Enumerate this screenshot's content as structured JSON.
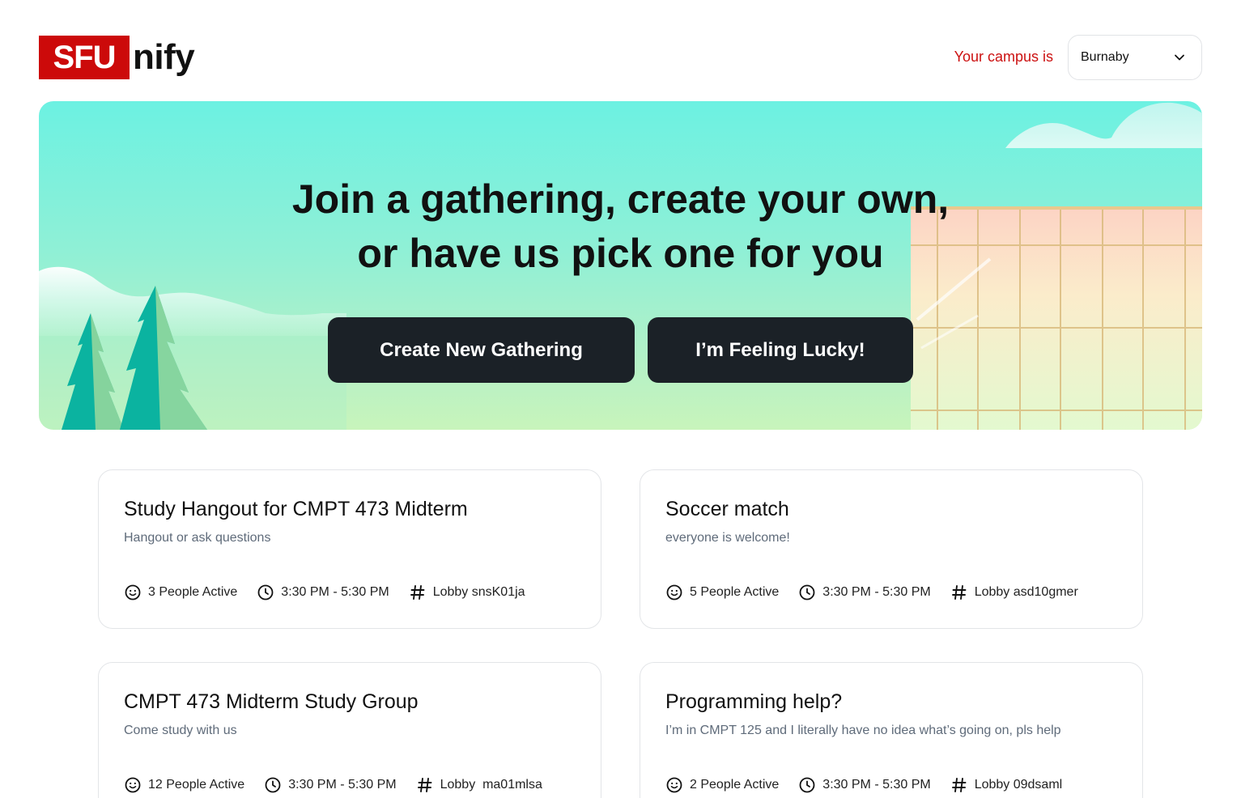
{
  "header": {
    "logo_mark": "SFU",
    "logo_rest": "nify",
    "campus_label": "Your campus is",
    "campus_value": "Burnaby"
  },
  "hero": {
    "title_line1": "Join a gathering, create your own,",
    "title_line2": "or have us pick one for you",
    "create_button": "Create New Gathering",
    "lucky_button": "I’m Feeling Lucky!"
  },
  "gatherings": [
    {
      "title": "Study Hangout for CMPT 473 Midterm",
      "description": "Hangout or ask questions",
      "active": "3 People Active",
      "time": "3:30 PM - 5:30 PM",
      "lobby": "Lobby snsK01ja"
    },
    {
      "title": "Soccer match",
      "description": "everyone is welcome!",
      "active": "5 People Active",
      "time": "3:30 PM - 5:30 PM",
      "lobby": "Lobby asd10gmer"
    },
    {
      "title": "CMPT 473 Midterm Study Group",
      "description": "Come study with us",
      "active": "12 People Active",
      "time": "3:30 PM - 5:30 PM",
      "lobby": "Lobby  ma01mlsa"
    },
    {
      "title": "Programming help?",
      "description": "I’m in CMPT 125 and I literally have no idea what’s going on, pls help",
      "active": "2 People Active",
      "time": "3:30 PM - 5:30 PM",
      "lobby": "Lobby 09dsaml"
    }
  ],
  "colors": {
    "brand_red": "#cc0a0a",
    "button_dark": "#1b2127",
    "hero_top": "#6cf1e2",
    "hero_bottom": "#c8f4bb"
  },
  "icons": {
    "active": "smiley-icon",
    "time": "clock-icon",
    "lobby": "hash-icon",
    "dropdown": "chevron-down-icon"
  }
}
